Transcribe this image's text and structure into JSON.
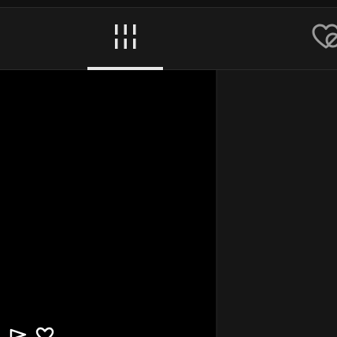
{
  "tabs": [
    {
      "id": "grid",
      "icon": "grid-icon",
      "selected": true
    },
    {
      "id": "favorites",
      "icon": "heart-off-icon",
      "selected": false
    }
  ],
  "colors": {
    "background": "#161616",
    "tab_bar": "#181818",
    "media_background": "#000000",
    "icon_active": "#e6e6e6",
    "icon_inactive": "#9a9a9a",
    "underline": "#e6e6e6"
  },
  "media": {
    "overlay_icons": [
      "send-icon",
      "heart-outline-icon"
    ]
  }
}
